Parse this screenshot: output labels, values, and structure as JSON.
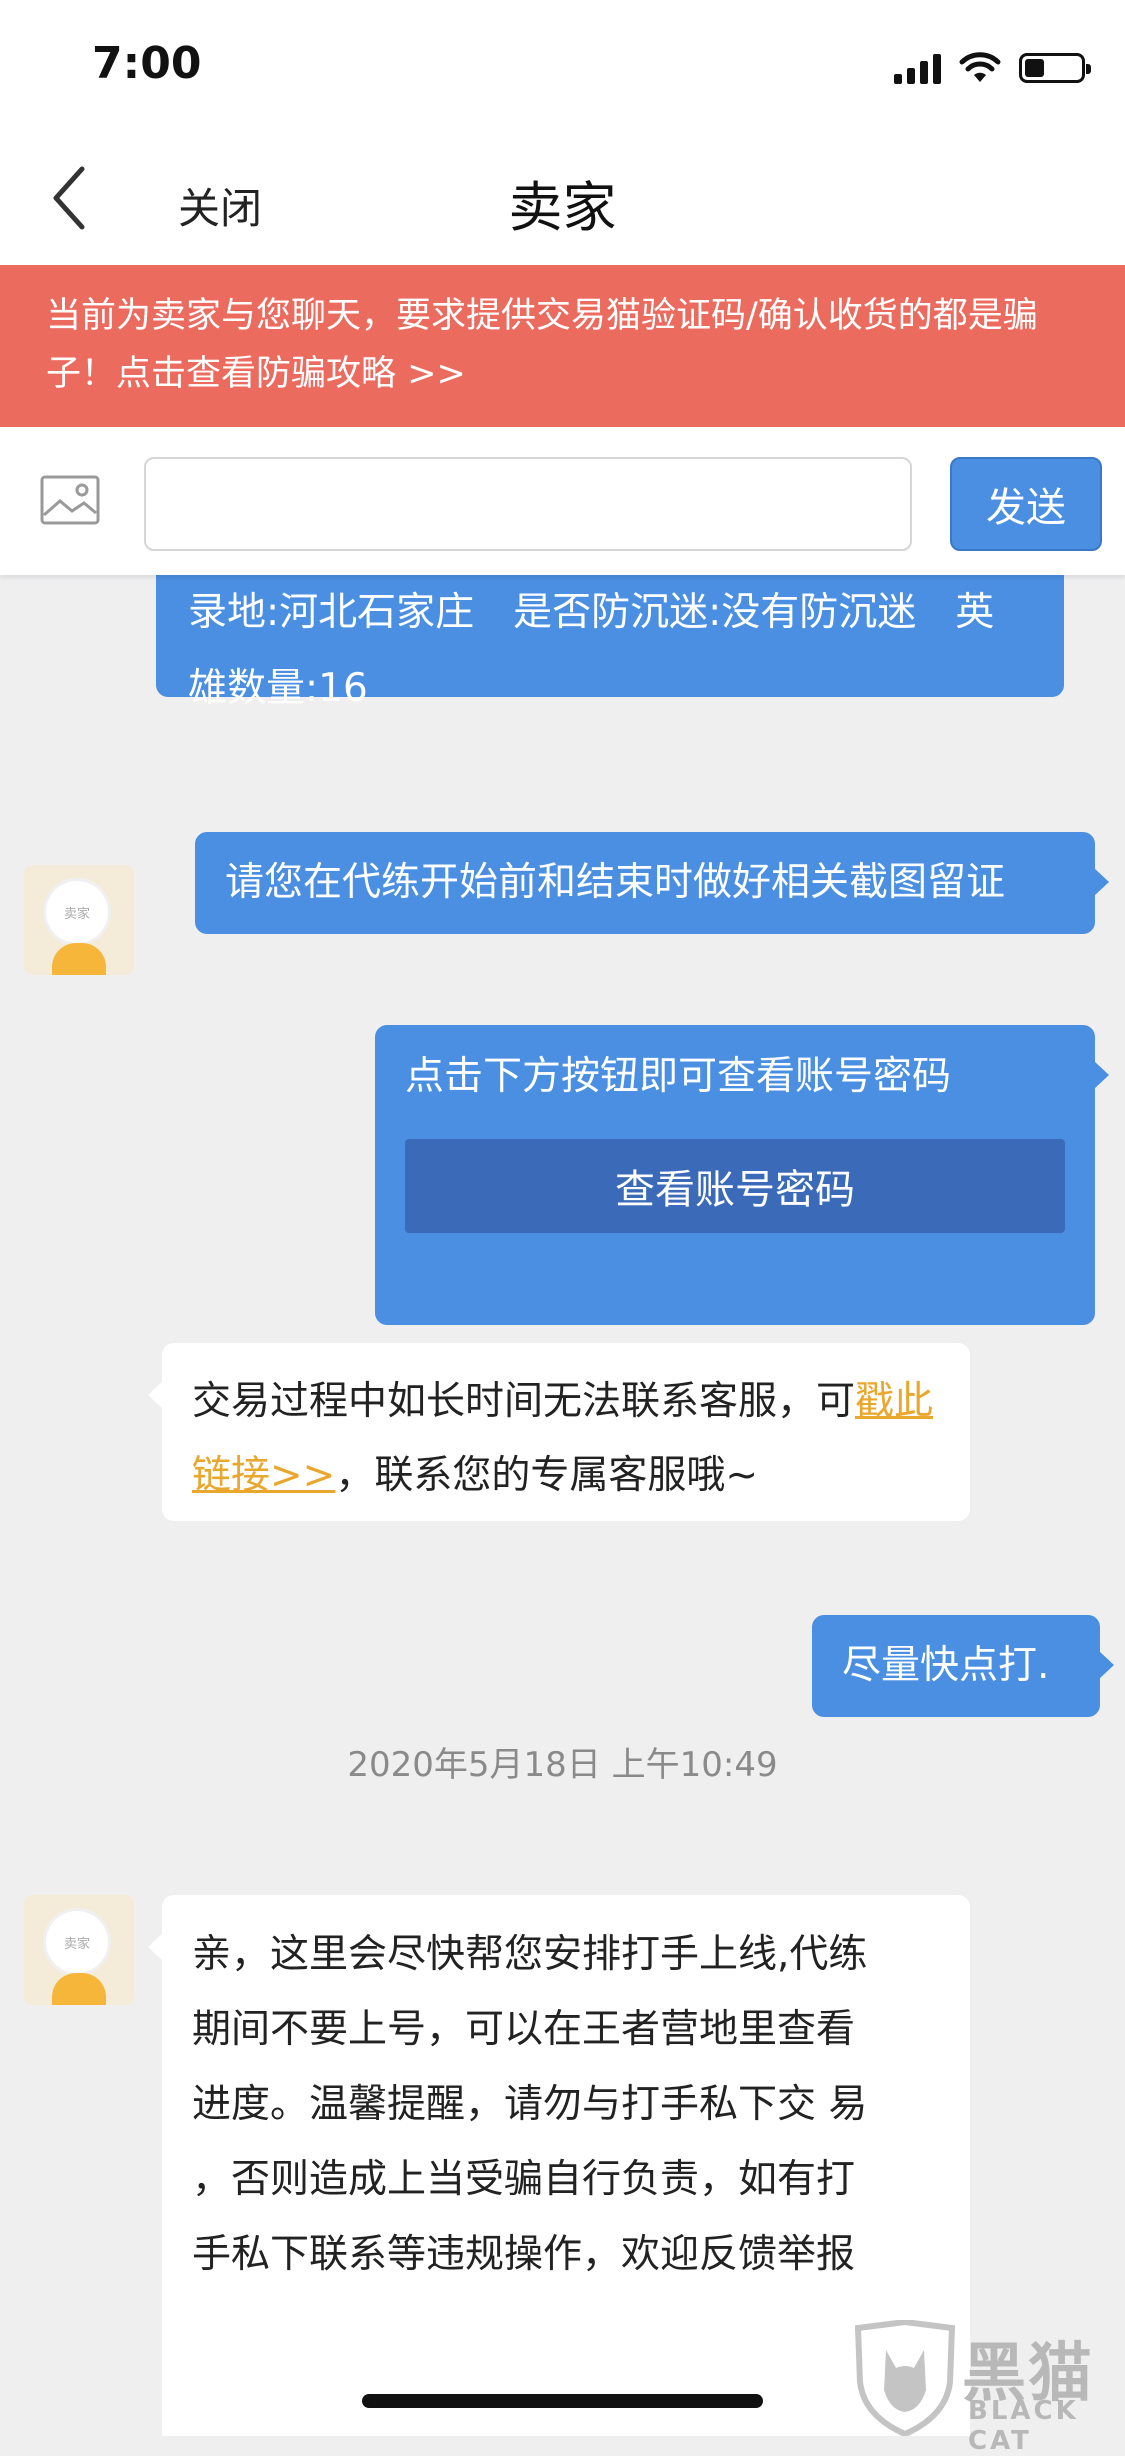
{
  "status_bar": {
    "time": "7:00",
    "battery_level": 0.35
  },
  "nav": {
    "back_icon": "chevron-left-icon",
    "close_label": "关闭",
    "title": "卖家"
  },
  "warning": {
    "line1": "当前为卖家与您聊天，要求提供交易猫验证码/确认收货的都是骗",
    "line2": "子！点击查看防骗攻略 >>"
  },
  "input_bar": {
    "image_icon": "image-icon",
    "input_value": "",
    "send_label": "发送"
  },
  "messages": [
    {
      "sender": "user",
      "text": "录地:河北石家庄　是否防沉迷:没有防沉迷　英雄数量:16"
    },
    {
      "sender": "user",
      "text": "请您在代练开始前和结束时做好相关截图留证"
    },
    {
      "sender": "user",
      "text": "点击下方按钮即可查看账号密码",
      "button_label": "查看账号密码"
    },
    {
      "sender": "seller",
      "avatar_label": "卖家",
      "text_before": "交易过程中如长时间无法联系客服，可",
      "link_text": "戳此链接>>",
      "text_after": "，联系您的专属客服哦~"
    },
    {
      "sender": "user",
      "text": "尽量快点打."
    },
    {
      "type": "timestamp",
      "text": "2020年5月18日 上午10:49"
    },
    {
      "sender": "seller",
      "avatar_label": "卖家",
      "lines": [
        "亲，这里会尽快帮您安排打手上线,代练",
        "期间不要上号，可以在王者营地里查看",
        "进度。温馨提醒，请勿与打手私下交 易",
        "，否则造成上当受骗自行负责，如有打",
        "手私下联系等违规操作，欢迎反馈举报"
      ]
    }
  ],
  "watermark": {
    "title": "黑猫",
    "subtitle": "BLACK CAT"
  },
  "colors": {
    "accent_blue": "#4a8fe2",
    "warning_red": "#ec6b5f",
    "link_orange": "#e9a72e",
    "chat_background": "#efeff0"
  }
}
